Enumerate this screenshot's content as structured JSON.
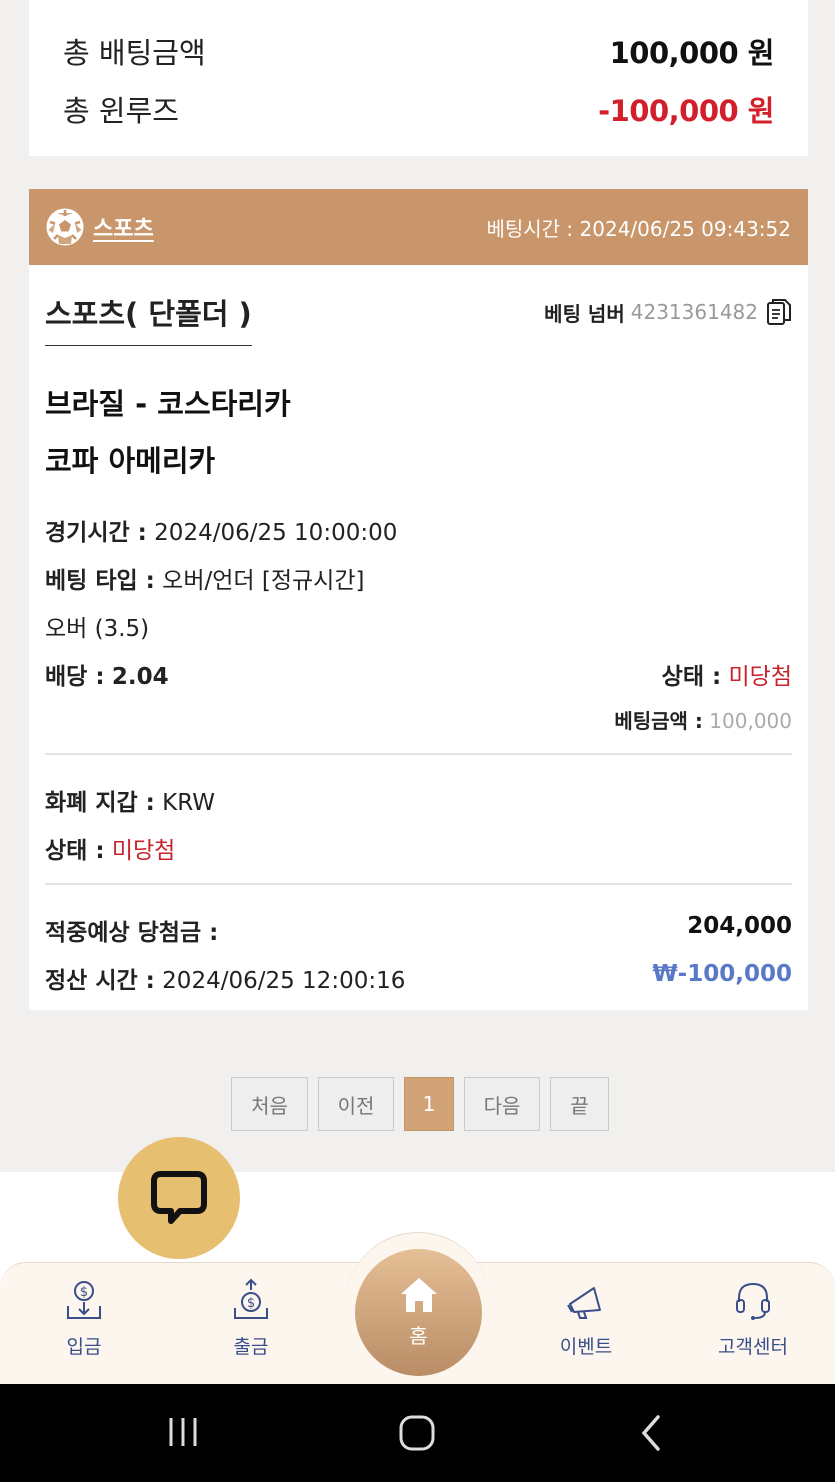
{
  "summary": {
    "total_bet_label": "총 배팅금액",
    "total_bet_value": "100,000 원",
    "total_winloss_label": "총 윈루즈",
    "total_winloss_value": "-100,000 원"
  },
  "bet": {
    "category": "스포츠",
    "bet_time_label": "베팅시간 :",
    "bet_time": "2024/06/25 09:43:52",
    "type_title": "스포츠( 단폴더 )",
    "bet_number_label": "베팅 넘버",
    "bet_number": "4231361482",
    "match_name": "브라질 - 코스타리카",
    "league": "코파 아메리카",
    "game_time_label": "경기시간 :",
    "game_time": "2024/06/25 10:00:00",
    "bet_type_label": "베팅 타입 :",
    "bet_type": "오버/언더 [정규시간]",
    "selection": "오버 (3.5)",
    "odds_label": "배당 :",
    "odds": "2.04",
    "pick_status_label": "상태 :",
    "pick_status": "미당첨",
    "bet_amount_label": "베팅금액 :",
    "bet_amount": "100,000",
    "wallet_label": "화폐 지갑 :",
    "wallet": "KRW",
    "status_label": "상태 :",
    "status": "미당첨",
    "expected_win_label": "적중예상 당첨금 :",
    "expected_win": "204,000",
    "settle_time_label": "정산 시간 :",
    "settle_time": "2024/06/25 12:00:16",
    "settle_amount": "₩-100,000"
  },
  "pagination": {
    "first": "처음",
    "prev": "이전",
    "current": "1",
    "next": "다음",
    "last": "끝"
  },
  "nav": {
    "deposit": "입금",
    "withdraw": "출금",
    "home": "홈",
    "event": "이벤트",
    "support": "고객센터"
  },
  "colors": {
    "accent": "#c8966a",
    "loss_red": "#d21f2b",
    "settle_blue": "#5a78c8",
    "chat_yellow": "#e6bf70"
  }
}
